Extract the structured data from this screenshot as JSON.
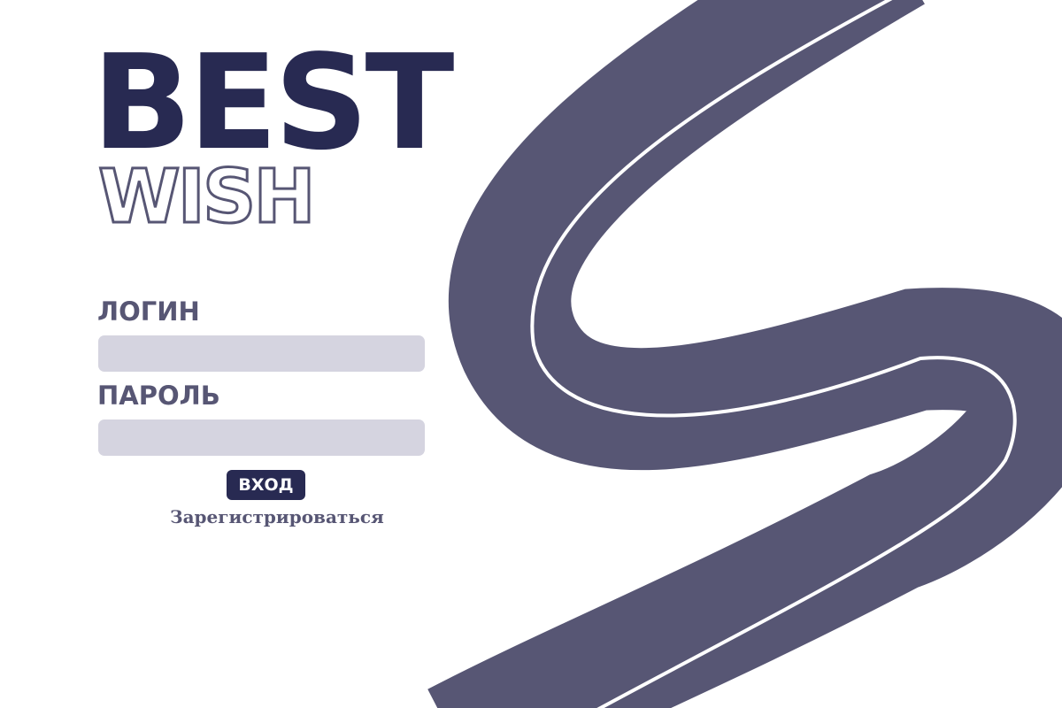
{
  "logo": {
    "line1": "BEST",
    "line2": "WISH"
  },
  "form": {
    "login_label": "ЛОГИН",
    "login_value": "",
    "password_label": "ПАРОЛЬ",
    "password_value": "",
    "submit_label": "ВХОД",
    "register_link": "Зарегистрироваться"
  },
  "decoration": {
    "icon": "s-ribbon-graphic"
  },
  "colors": {
    "brand_dark": "#282a52",
    "brand_muted": "#575674",
    "input_bg": "#d5d4e0",
    "background": "#ffffff"
  }
}
